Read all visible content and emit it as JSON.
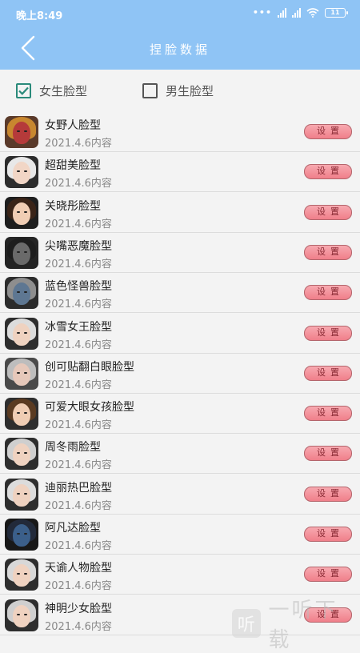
{
  "status": {
    "time": "晚上8:49",
    "battery": "11"
  },
  "header": {
    "title": "捏脸数据"
  },
  "filters": [
    {
      "label": "女生脸型",
      "checked": true
    },
    {
      "label": "男生脸型",
      "checked": false
    }
  ],
  "items": [
    {
      "name": "女野人脸型",
      "date": "2021.4.6内容",
      "button": "设置"
    },
    {
      "name": "超甜美脸型",
      "date": "2021.4.6内容",
      "button": "设置"
    },
    {
      "name": "关晓彤脸型",
      "date": "2021.4.6内容",
      "button": "设置"
    },
    {
      "name": "尖嘴恶魔脸型",
      "date": "2021.4.6内容",
      "button": "设置"
    },
    {
      "name": "蓝色怪兽脸型",
      "date": "2021.4.6内容",
      "button": "设置"
    },
    {
      "name": "冰雪女王脸型",
      "date": "2021.4.6内容",
      "button": "设置"
    },
    {
      "name": "创可贴翻白眼脸型",
      "date": "2021.4.6内容",
      "button": "设置"
    },
    {
      "name": "可爱大眼女孩脸型",
      "date": "2021.4.6内容",
      "button": "设置"
    },
    {
      "name": "周冬雨脸型",
      "date": "2021.4.6内容",
      "button": "设置"
    },
    {
      "name": "迪丽热巴脸型",
      "date": "2021.4.6内容",
      "button": "设置"
    },
    {
      "name": "阿凡达脸型",
      "date": "2021.4.6内容",
      "button": "设置"
    },
    {
      "name": "天谕人物脸型",
      "date": "2021.4.6内容",
      "button": "设置"
    },
    {
      "name": "神明少女脸型",
      "date": "2021.4.6内容",
      "button": "设置"
    }
  ],
  "avatar_styles": [
    {
      "bg": "#5a3a2a",
      "hair": "#c8872f",
      "face": "#b53a3a"
    },
    {
      "bg": "#2d2d2d",
      "hair": "#e8e8e8",
      "face": "#f1d6c6"
    },
    {
      "bg": "#1e1e1e",
      "hair": "#3a2418",
      "face": "#f0cdb4"
    },
    {
      "bg": "#242424",
      "hair": "#1d1d1d",
      "face": "#6a6a6a"
    },
    {
      "bg": "#2c2c2c",
      "hair": "#8e8e8e",
      "face": "#5e7792"
    },
    {
      "bg": "#2e2e2e",
      "hair": "#dcdcdc",
      "face": "#efd2c0"
    },
    {
      "bg": "#4a4a4a",
      "hair": "#bdbdbd",
      "face": "#e6c8ba"
    },
    {
      "bg": "#2e2e2e",
      "hair": "#5a3b22",
      "face": "#efcdb4"
    },
    {
      "bg": "#2e2e2e",
      "hair": "#cfcfcf",
      "face": "#efd2c0"
    },
    {
      "bg": "#2e2e2e",
      "hair": "#dcdcdc",
      "face": "#efd2c0"
    },
    {
      "bg": "#181818",
      "hair": "#222a3a",
      "face": "#3b5f8a"
    },
    {
      "bg": "#2e2e2e",
      "hair": "#d8d8d8",
      "face": "#efd2c0"
    },
    {
      "bg": "#2e2e2e",
      "hair": "#cfcfcf",
      "face": "#efd2c0"
    }
  ],
  "colors": {
    "header": "#8fc4f5",
    "checkbox": "#2a8a7a",
    "button": "#f07f8a"
  },
  "watermark": {
    "glyph": "听",
    "text": "一听下载"
  }
}
